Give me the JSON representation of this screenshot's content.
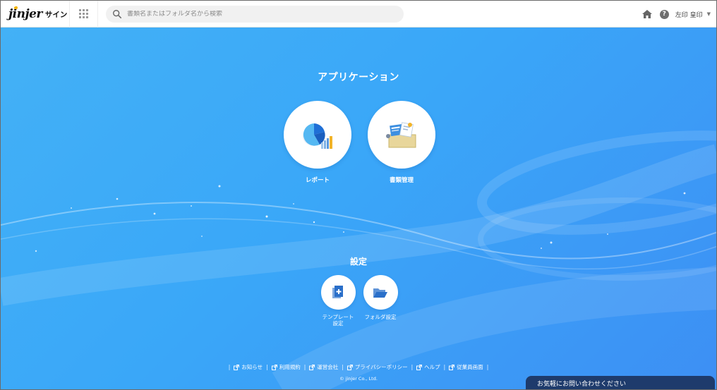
{
  "header": {
    "logo_main": "jinjer",
    "logo_sub": "サイン",
    "search_placeholder": "書類名またはフォルダ名から検索",
    "user_name": "左印 皇印"
  },
  "main": {
    "applications_title": "アプリケーション",
    "apps": [
      {
        "label": "レポート",
        "icon": "pie-chart-icon"
      },
      {
        "label": "書類管理",
        "icon": "document-box-icon"
      }
    ],
    "settings_title": "設定",
    "settings": [
      {
        "label_line1": "テンプレート",
        "label_line2": "設定",
        "icon": "template-icon"
      },
      {
        "label_line1": "フォルダ設定",
        "label_line2": "",
        "icon": "folder-open-icon"
      }
    ]
  },
  "footer": {
    "links": [
      "お知らせ",
      "利用規約",
      "運営会社",
      "プライバシーポリシー",
      "ヘルプ",
      "従業員画面"
    ],
    "copyright": "© jinjer Co., Ltd."
  },
  "contact": {
    "label": "お気軽にお問い合わせください"
  },
  "colors": {
    "accent": "#3aa7f8",
    "contact_bar": "#1e3b6c",
    "pie_blue": "#1f6fd6",
    "pie_light": "#55b8f2",
    "folder_gold": "#e8d69b"
  }
}
